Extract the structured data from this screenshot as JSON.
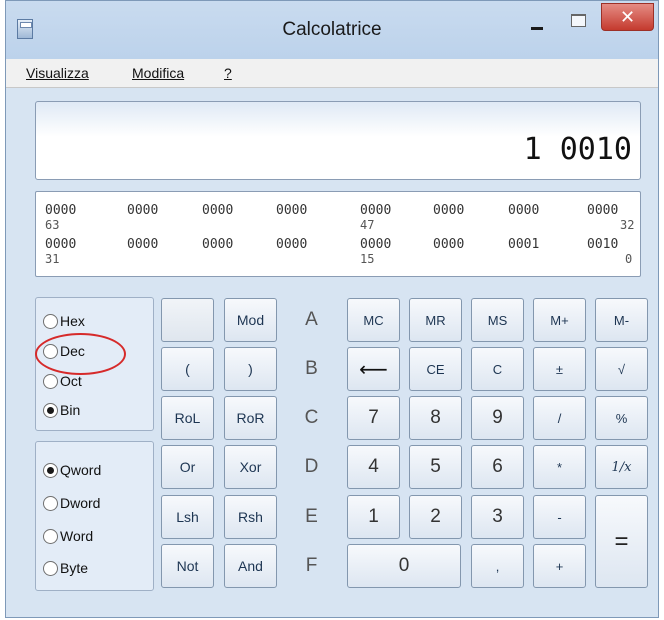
{
  "window": {
    "title": "Calcolatrice",
    "close_glyph": "✕"
  },
  "menu": {
    "view": "Visualizza",
    "edit": "Modifica",
    "help": "?"
  },
  "display": {
    "value": "1 0010"
  },
  "bits": {
    "row1": [
      "0000",
      "0000",
      "0000",
      "0000",
      "0000",
      "0000",
      "0000",
      "0000"
    ],
    "row1_labels": [
      "63",
      "47",
      "32"
    ],
    "row2": [
      "0000",
      "0000",
      "0000",
      "0000",
      "0000",
      "0000",
      "0001",
      "0010"
    ],
    "row2_labels": [
      "31",
      "15",
      "0"
    ]
  },
  "base": {
    "options": [
      "Hex",
      "Dec",
      "Oct",
      "Bin"
    ],
    "selected": "Bin"
  },
  "word": {
    "options": [
      "Qword",
      "Dword",
      "Word",
      "Byte"
    ],
    "selected": "Qword"
  },
  "keys": {
    "r1": [
      "",
      "Mod",
      "A",
      "MC",
      "MR",
      "MS",
      "M+",
      "M-"
    ],
    "r2": [
      "(",
      ")",
      "B",
      "⟵",
      "CE",
      "C",
      "±",
      "√"
    ],
    "r3": [
      "RoL",
      "RoR",
      "C",
      "7",
      "8",
      "9",
      "/",
      "%"
    ],
    "r4": [
      "Or",
      "Xor",
      "D",
      "4",
      "5",
      "6",
      "*",
      "1/x"
    ],
    "r5": [
      "Lsh",
      "Rsh",
      "E",
      "1",
      "2",
      "3",
      "-"
    ],
    "r6": [
      "Not",
      "And",
      "F",
      "0",
      ",",
      "+"
    ],
    "equals": "="
  },
  "colors": {
    "highlight": "#d62a2a",
    "close": "#c43a2e"
  }
}
